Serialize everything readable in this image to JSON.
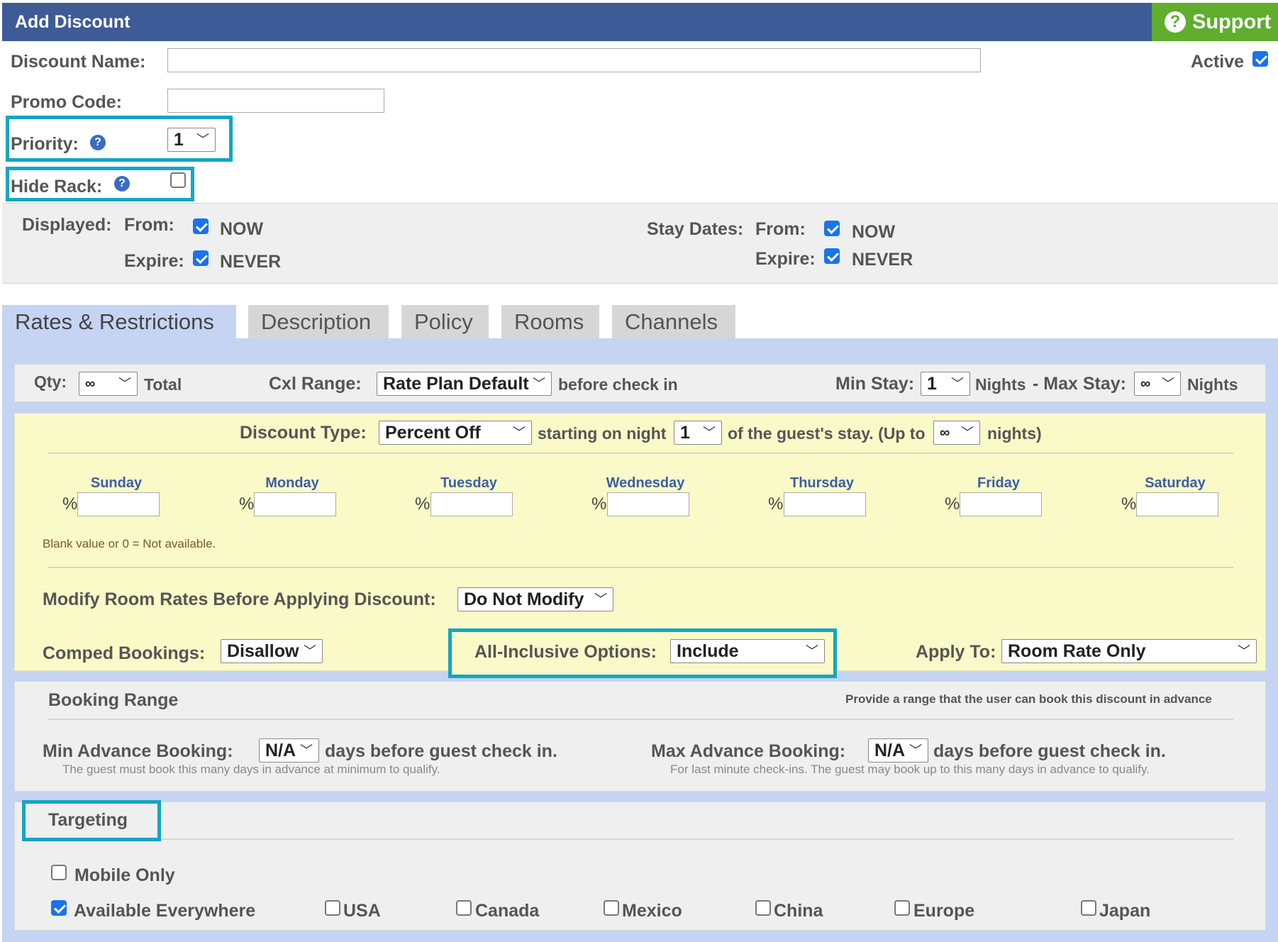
{
  "header": {
    "title": "Add Discount",
    "support_label": "Support",
    "support_icon": "?"
  },
  "form": {
    "discount_name_label": "Discount Name:",
    "discount_name_value": "",
    "active_label": "Active",
    "active_checked": true,
    "promo_code_label": "Promo Code:",
    "promo_code_value": "",
    "priority_label": "Priority:",
    "priority_value": "1",
    "hide_rack_label": "Hide Rack:",
    "hide_rack_checked": false
  },
  "dates": {
    "displayed_label": "Displayed:",
    "from_label": "From:",
    "expire_label": "Expire:",
    "displayed_from_value": "NOW",
    "displayed_expire_value": "NEVER",
    "stay_dates_label": "Stay Dates:",
    "stay_from_value": "NOW",
    "stay_expire_value": "NEVER"
  },
  "tabs": [
    {
      "label": "Rates & Restrictions",
      "active": true
    },
    {
      "label": "Description",
      "active": false
    },
    {
      "label": "Policy",
      "active": false
    },
    {
      "label": "Rooms",
      "active": false
    },
    {
      "label": "Channels",
      "active": false
    }
  ],
  "restrictions": {
    "qty_label": "Qty:",
    "qty_value": "∞",
    "total_label": "Total",
    "cxl_label": "Cxl Range:",
    "cxl_value": "Rate Plan Default",
    "before_checkin": "before check in",
    "min_stay_label": "Min Stay:",
    "min_stay_value": "1",
    "nights_label": "Nights",
    "max_stay_label": "- Max Stay:",
    "max_stay_value": "∞",
    "nights_label2": "Nights"
  },
  "discount": {
    "type_label": "Discount Type:",
    "type_value": "Percent Off",
    "starting_label": "starting on night",
    "starting_value": "1",
    "guest_stay_label": "of the guest's stay. (Up to",
    "up_to_value": "∞",
    "nights_close": "nights)",
    "pct_symbol": "%",
    "days": [
      "Sunday",
      "Monday",
      "Tuesday",
      "Wednesday",
      "Thursday",
      "Friday",
      "Saturday"
    ],
    "blank_note": "Blank value or 0 = Not available.",
    "modify_label": "Modify Room Rates Before Applying Discount:",
    "modify_value": "Do Not Modify",
    "comped_label": "Comped Bookings:",
    "comped_value": "Disallow",
    "all_inclusive_label": "All-Inclusive Options:",
    "all_inclusive_value": "Include",
    "apply_to_label": "Apply To:",
    "apply_to_value": "Room Rate Only"
  },
  "booking": {
    "title": "Booking Range",
    "hint": "Provide a range that the user can book this discount in advance",
    "min_label": "Min Advance Booking:",
    "min_value": "N/A",
    "days_before": "days before guest check in.",
    "min_note": "The guest must book this many days in advance at minimum to qualify.",
    "max_label": "Max Advance Booking:",
    "max_value": "N/A",
    "max_note": "For last minute check-ins. The guest may book up to this many days in advance to qualify."
  },
  "targeting": {
    "title": "Targeting",
    "mobile_only_label": "Mobile Only",
    "mobile_only_checked": false,
    "available_everywhere_label": "Available Everywhere",
    "available_everywhere_checked": true,
    "regions": [
      {
        "label": "USA",
        "checked": false
      },
      {
        "label": "Canada",
        "checked": false
      },
      {
        "label": "Mexico",
        "checked": false
      },
      {
        "label": "China",
        "checked": false
      },
      {
        "label": "Europe",
        "checked": false
      },
      {
        "label": "Japan",
        "checked": false
      }
    ]
  },
  "colors": {
    "header": "#3e5b97",
    "support": "#5fae2e",
    "highlight": "#12a6c4",
    "tab_body": "#c5d4f2",
    "yellow_panel": "#fafac8",
    "day_label": "#3b5ea8"
  },
  "icons": {
    "help": "help-circle-icon",
    "dropdown": "chevron-down-icon",
    "support": "question-circle-icon"
  }
}
